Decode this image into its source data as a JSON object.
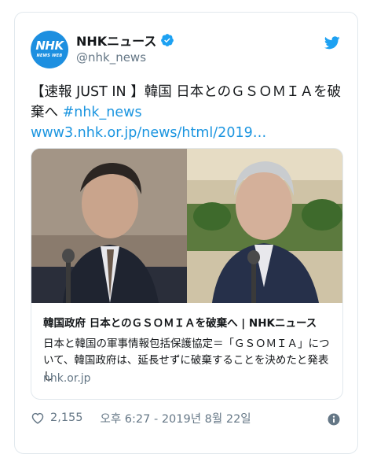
{
  "account": {
    "avatar_text": "NHK",
    "avatar_subtext": "NEWS WEB",
    "display_name": "NHKニュース",
    "handle": "@nhk_news"
  },
  "tweet": {
    "text_main": "【速報 JUST IN 】韓国 日本とのＧＳＯＭＩＡを破棄へ ",
    "hashtag": "#nhk_news",
    "link": "www3.nhk.or.jp/news/html/2019…"
  },
  "link_card": {
    "title": "韓国政府 日本とのＧＳＯＭＩＡを破棄へ | NHKニュース",
    "description": "日本と韓国の軍事情報包括保護協定＝「ＧＳＯＭＩＡ」について、韓国政府は、延長せずに破棄することを決めたと発表し",
    "domain": "nhk.or.jp"
  },
  "footer": {
    "like_count": "2,155",
    "timestamp": "오후 6:27 - 2019년 8월 22일"
  },
  "colors": {
    "brand_blue": "#1b95e0",
    "twitter_blue": "#1da1f2",
    "text_secondary": "#657786",
    "border": "#e1e8ed"
  },
  "icons": [
    "verified-badge-icon",
    "twitter-bird-icon",
    "heart-icon",
    "info-icon"
  ]
}
